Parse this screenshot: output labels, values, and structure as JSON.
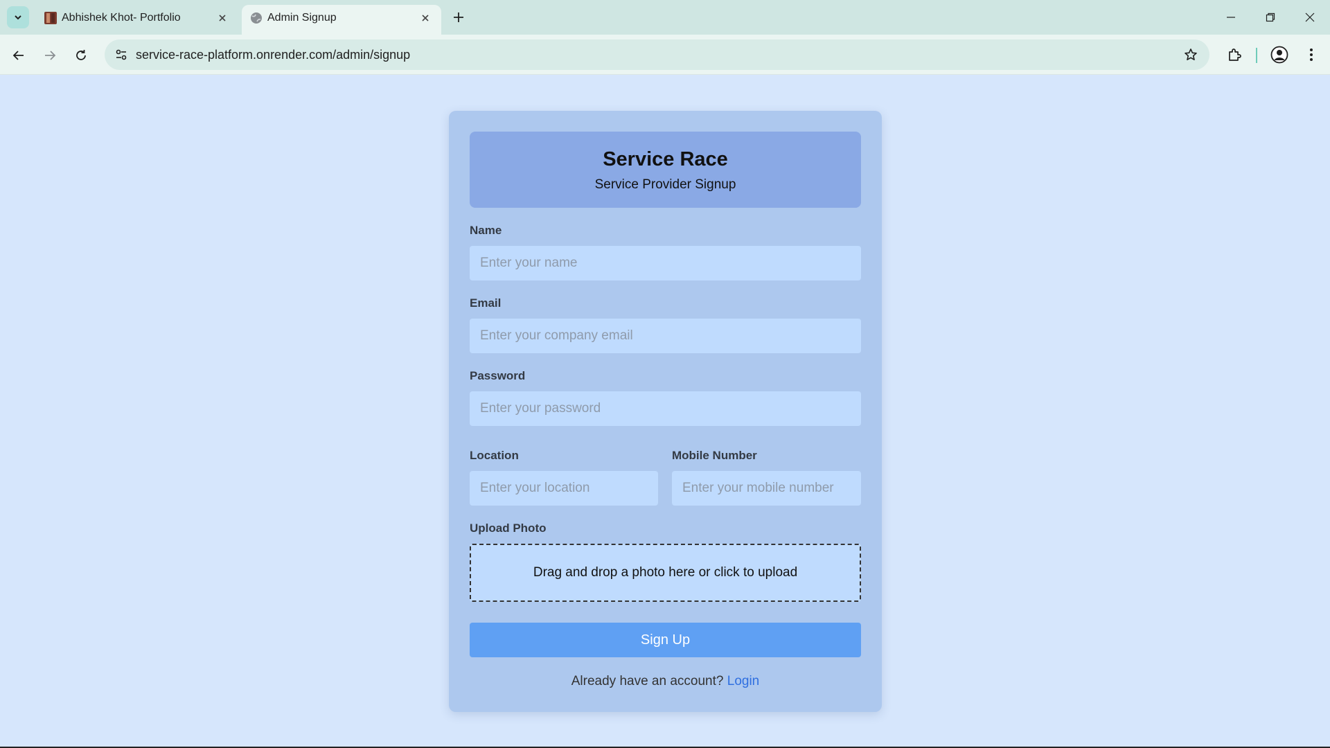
{
  "browser": {
    "tabs": [
      {
        "title": "Abhishek Khot- Portfolio",
        "active": false,
        "favicon": "portfolio-photo-icon"
      },
      {
        "title": "Admin Signup",
        "active": true,
        "favicon": "globe-icon"
      }
    ],
    "url": "service-race-platform.onrender.com/admin/signup"
  },
  "header": {
    "brand": "Service Race",
    "subtitle": "Service Provider Signup"
  },
  "form": {
    "name_label": "Name",
    "name_placeholder": "Enter your name",
    "email_label": "Email",
    "email_placeholder": "Enter your company email",
    "password_label": "Password",
    "password_placeholder": "Enter your password",
    "location_label": "Location",
    "location_placeholder": "Enter your location",
    "mobile_label": "Mobile Number",
    "mobile_placeholder": "Enter your mobile number",
    "upload_label": "Upload Photo",
    "upload_text": "Drag and drop a photo here or click to upload",
    "submit_label": "Sign Up",
    "login_prompt": "Already have an account?",
    "login_link": "Login"
  },
  "colors": {
    "page_background": "#d6e6fc",
    "card_background": "#adc8ee",
    "header_background": "#8aa9e5",
    "input_background": "#bfdbfe",
    "button_background": "#5fa0f3",
    "link": "#2f6fe0"
  }
}
